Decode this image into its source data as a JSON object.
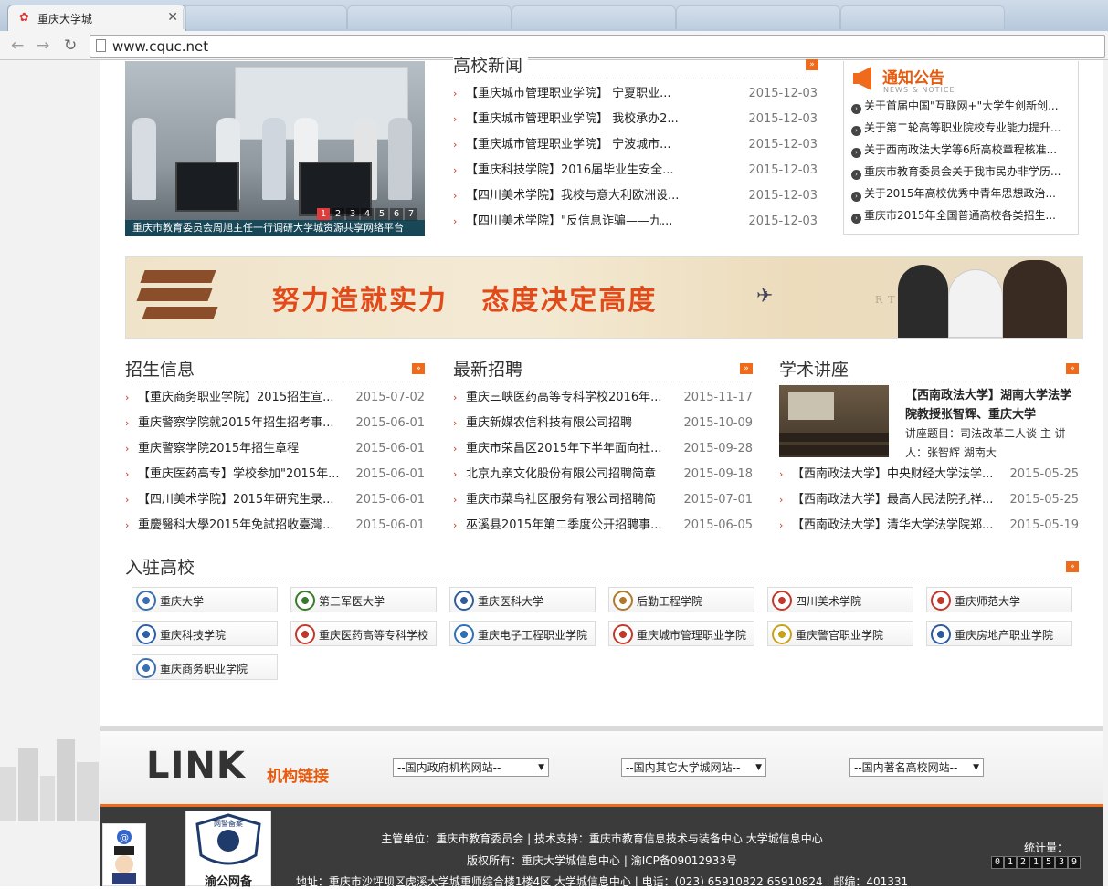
{
  "browser": {
    "tab_title": "重庆大学城",
    "url": "www.cquc.net"
  },
  "slideshow": {
    "caption": "重庆市教育委员会周旭主任一行调研大学城资源共享网络平台",
    "pages": [
      "1",
      "2",
      "3",
      "4",
      "5",
      "6",
      "7"
    ],
    "active_page": "1"
  },
  "news": {
    "title": "高校新闻",
    "items": [
      {
        "text": "【重庆城市管理职业学院】 宁夏职业...",
        "date": "2015-12-03"
      },
      {
        "text": "【重庆城市管理职业学院】 我校承办2...",
        "date": "2015-12-03"
      },
      {
        "text": "【重庆城市管理职业学院】 宁波城市...",
        "date": "2015-12-03"
      },
      {
        "text": "【重庆科技学院】2016届毕业生安全...",
        "date": "2015-12-03"
      },
      {
        "text": "【四川美术学院】我校与意大利欧洲设...",
        "date": "2015-12-03"
      },
      {
        "text": "【四川美术学院】\"反信息诈骗——九...",
        "date": "2015-12-03"
      }
    ]
  },
  "notice": {
    "title": "通知公告",
    "subtitle": "NEWS & NOTICE",
    "items": [
      "关于首届中国\"互联网+\"大学生创新创...",
      "关于第二轮高等职业院校专业能力提升...",
      "关于西南政法大学等6所高校章程核准...",
      "重庆市教育委员会关于我市民办非学历...",
      "关于2015年高校优秀中青年思想政治...",
      "重庆市2015年全国普通高校各类招生..."
    ]
  },
  "banner": {
    "slogan": "努力造就实力   态度决定高度",
    "map_text": "RTH  AMERICA"
  },
  "admissions": {
    "title": "招生信息",
    "items": [
      {
        "text": "【重庆商务职业学院】2015招生宣...",
        "date": "2015-07-02"
      },
      {
        "text": "重庆警察学院就2015年招生招考事...",
        "date": "2015-06-01"
      },
      {
        "text": "重庆警察学院2015年招生章程",
        "date": "2015-06-01"
      },
      {
        "text": "【重庆医药高专】学校参加\"2015年...",
        "date": "2015-06-01"
      },
      {
        "text": "【四川美术学院】2015年研究生录...",
        "date": "2015-06-01"
      },
      {
        "text": "重慶醫科大學2015年免試招收臺灣...",
        "date": "2015-06-01"
      }
    ]
  },
  "jobs": {
    "title": "最新招聘",
    "items": [
      {
        "text": "重庆三峡医药高等专科学校2016年...",
        "date": "2015-11-17"
      },
      {
        "text": "重庆新媒农信科技有限公司招聘",
        "date": "2015-10-09"
      },
      {
        "text": "重庆市荣昌区2015年下半年面向社...",
        "date": "2015-09-28"
      },
      {
        "text": "北京九亲文化股份有限公司招聘简章",
        "date": "2015-09-18"
      },
      {
        "text": "重庆市菜鸟社区服务有限公司招聘简",
        "date": "2015-07-01"
      },
      {
        "text": "巫溪县2015年第二季度公开招聘事...",
        "date": "2015-06-05"
      }
    ]
  },
  "lectures": {
    "title": "学术讲座",
    "featured_title": "【西南政法大学】湖南大学法学院教授张智辉、重庆大学",
    "featured_desc": "讲座题目：司法改革二人谈 主 讲人：张智辉 湖南大",
    "items": [
      {
        "text": "【西南政法大学】中央财经大学法学...",
        "date": "2015-05-25"
      },
      {
        "text": "【西南政法大学】最高人民法院孔祥...",
        "date": "2015-05-25"
      },
      {
        "text": "【西南政法大学】清华大学法学院郑...",
        "date": "2015-05-19"
      }
    ]
  },
  "universities": {
    "title": "入驻高校",
    "items": [
      {
        "name": "重庆大学",
        "color": "#3a6fb0"
      },
      {
        "name": "第三军医大学",
        "color": "#3b7a2a"
      },
      {
        "name": "重庆医科大学",
        "color": "#2f5d9a"
      },
      {
        "name": "后勤工程学院",
        "color": "#b07a2a"
      },
      {
        "name": "四川美术学院",
        "color": "#c0392b"
      },
      {
        "name": "重庆师范大学",
        "color": "#c0392b"
      },
      {
        "name": "重庆科技学院",
        "color": "#2b5fa8"
      },
      {
        "name": "重庆医药高等专科学校",
        "color": "#c0392b"
      },
      {
        "name": "重庆电子工程职业学院",
        "color": "#2e6fb5"
      },
      {
        "name": "重庆城市管理职业学院",
        "color": "#c0392b"
      },
      {
        "name": "重庆警官职业学院",
        "color": "#c9a21b"
      },
      {
        "name": "重庆房地产职业学院",
        "color": "#2d5b9a"
      },
      {
        "name": "重庆商务职业学院",
        "color": "#3a6fb0"
      }
    ]
  },
  "links": {
    "title": "LINK",
    "subtitle": "机构链接",
    "selects": [
      "--国内政府机构网站--",
      "--国内其它大学城网站--",
      "--国内著名高校网站--"
    ]
  },
  "footer": {
    "line1": "主管单位：重庆市教育委员会 | 技术支持：重庆市教育信息技术与装备中心 大学城信息中心",
    "line2": "版权所有：重庆大学城信息中心 | 渝ICP备09012933号",
    "line3": "地址：重庆市沙坪坝区虎溪大学城重师综合楼1楼4区 大学城信息中心 | 电话：(023) 65910822 65910824 | 邮编：401331",
    "badge_text": "渝公网备",
    "counter_label": "统计量：",
    "counter_digits": [
      "0",
      "1",
      "2",
      "1",
      "5",
      "3",
      "9"
    ]
  },
  "colors": {
    "accent": "#e85a0c",
    "footer_bg": "#3b3b3b",
    "arrow": "#c8391f"
  }
}
